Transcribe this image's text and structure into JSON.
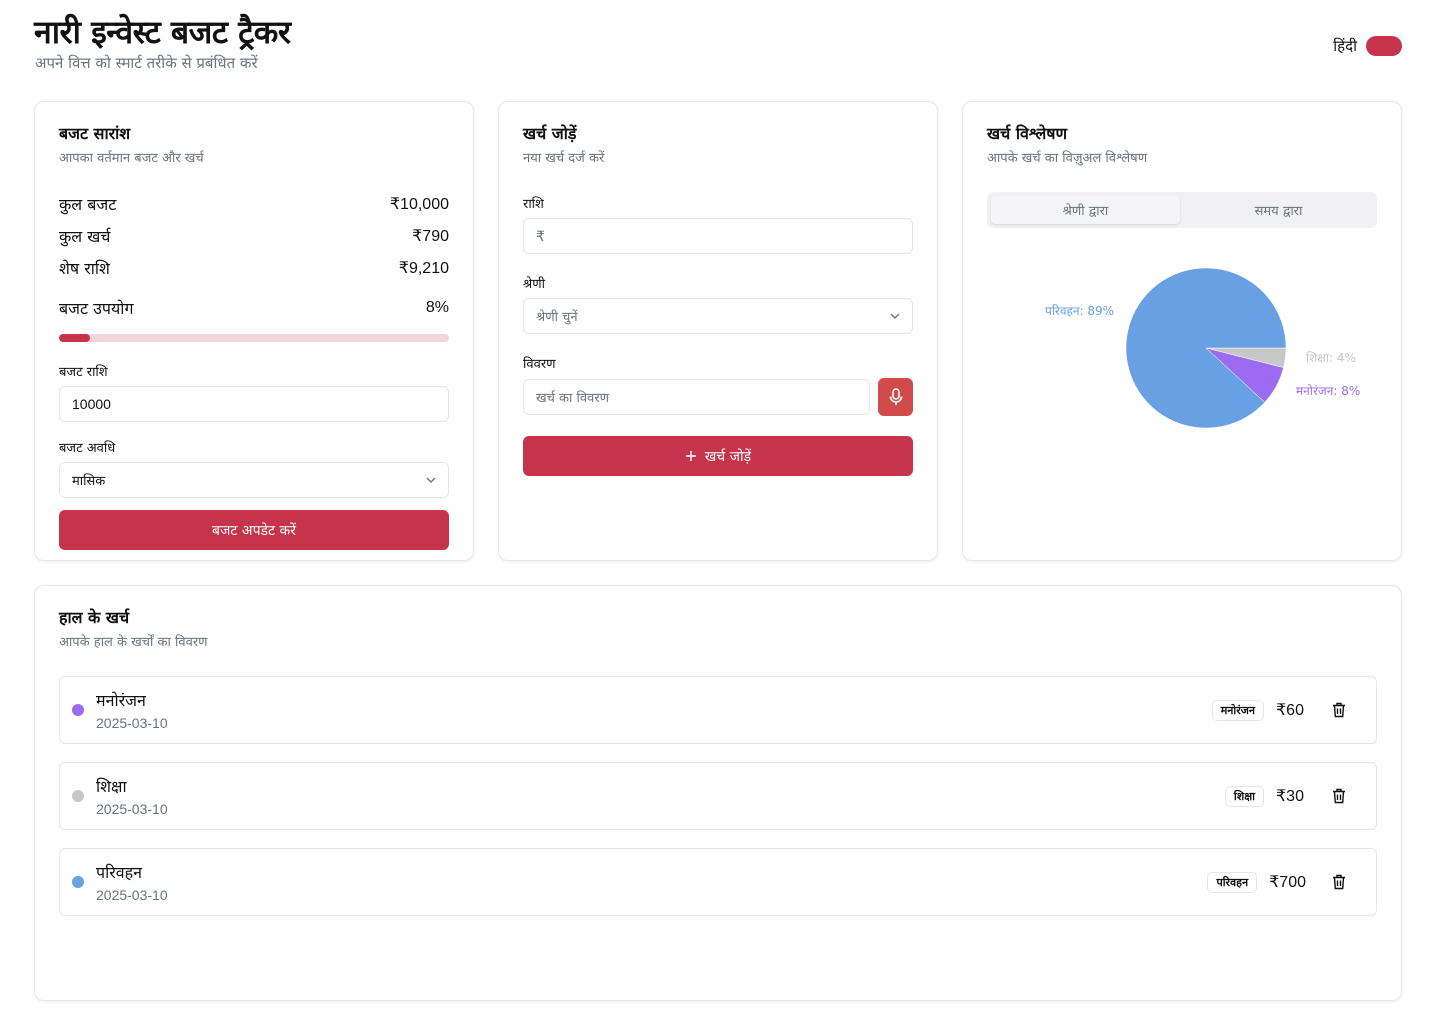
{
  "header": {
    "title": "नारी इन्वेस्ट बजट ट्रैकर",
    "subtitle": "अपने वित्त को स्मार्ट तरीके से प्रबंधित करें",
    "language_label": "हिंदी",
    "accent_color": "#c5344b"
  },
  "budget_summary": {
    "title": "बजट सारांश",
    "description": "आपका वर्तमान बजट और खर्च",
    "rows": [
      {
        "label": "कुल बजट",
        "value": "₹10,000"
      },
      {
        "label": "कुल खर्च",
        "value": "₹790"
      },
      {
        "label": "शेष राशि",
        "value": "₹9,210"
      }
    ],
    "usage_label": "बजट उपयोग",
    "usage_value": "8%",
    "usage_fraction": 0.08,
    "amount_label": "बजट राशि",
    "amount_value": "10000",
    "period_label": "बजट अवधि",
    "period_value": "मासिक",
    "update_button": "बजट अपडेट करें"
  },
  "add_expense": {
    "title": "खर्च जोड़ें",
    "description": "नया खर्च दर्ज करें",
    "amount_label": "राशि",
    "amount_placeholder": "₹",
    "category_label": "श्रेणी",
    "category_placeholder": "श्रेणी चुनें",
    "description_label": "विवरण",
    "description_placeholder": "खर्च का विवरण",
    "add_button": "खर्च जोड़ें",
    "add_icon": "plus-icon",
    "mic_icon": "microphone-icon"
  },
  "analysis": {
    "title": "खर्च विश्लेषण",
    "description": "आपके खर्च का विज़ुअल विश्लेषण",
    "tabs": [
      {
        "label": "श्रेणी द्वारा",
        "active": true
      },
      {
        "label": "समय द्वारा",
        "active": false
      }
    ]
  },
  "chart_data": {
    "type": "pie",
    "slices": [
      {
        "label": "परिवहन: 89%",
        "value": 89,
        "color": "#67a0e3"
      },
      {
        "label": "मनोरंजन: 8%",
        "value": 8,
        "color": "#9b6bf2"
      },
      {
        "label": "शिक्षा: 4%",
        "value": 4,
        "color": "#c8c8c8"
      }
    ]
  },
  "recent": {
    "title": "हाल के खर्च",
    "description": "आपके हाल के खर्चों का विवरण",
    "items": [
      {
        "name": "मनोरंजन",
        "date": "2025-03-10",
        "badge": "मनोरंजन",
        "amount": "₹60",
        "color": "#9b6bf2"
      },
      {
        "name": "शिक्षा",
        "date": "2025-03-10",
        "badge": "शिक्षा",
        "amount": "₹30",
        "color": "#c8c8c8"
      },
      {
        "name": "परिवहन",
        "date": "2025-03-10",
        "badge": "परिवहन",
        "amount": "₹700",
        "color": "#67a0e3"
      }
    ],
    "delete_icon": "trash-icon"
  }
}
